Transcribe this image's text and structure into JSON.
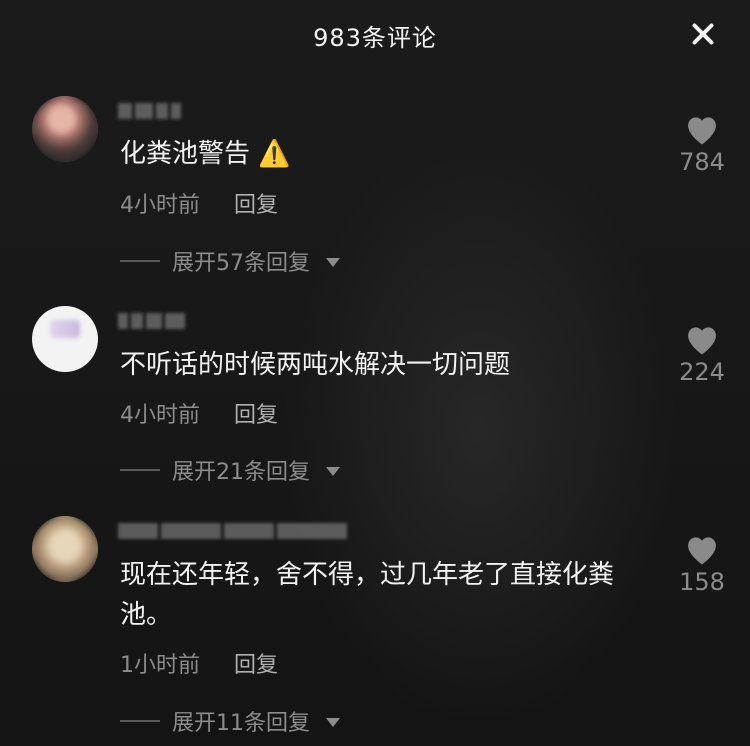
{
  "header": {
    "title": "983条评论"
  },
  "comments": [
    {
      "text": "化粪池警告",
      "warning_icon": "⚠️",
      "time": "4小时前",
      "reply_label": "回复",
      "expand_label": "展开57条回复",
      "likes": "784"
    },
    {
      "text": "不听话的时候两吨水解决一切问题",
      "time": "4小时前",
      "reply_label": "回复",
      "expand_label": "展开21条回复",
      "likes": "224"
    },
    {
      "text": "现在还年轻，舍不得，过几年老了直接化粪池。",
      "time": "1小时前",
      "reply_label": "回复",
      "expand_label": "展开11条回复",
      "likes": "158"
    }
  ],
  "colors": {
    "background": "#161616",
    "muted_text": "#8c8c8c",
    "warning": "#f3c21a"
  },
  "icons": {
    "close": "close-icon",
    "like": "heart-icon",
    "expand": "caret-down-icon",
    "warning": "warning-icon"
  }
}
